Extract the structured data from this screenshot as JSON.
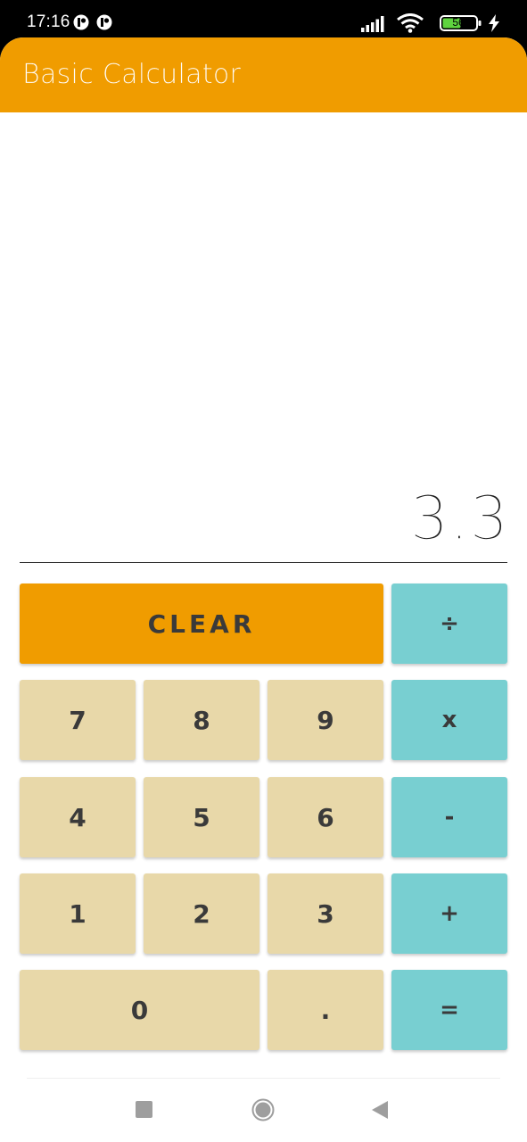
{
  "status_bar": {
    "time": "17:16",
    "battery_level": "56",
    "icons": [
      "app-notification-icon",
      "app-notification-icon",
      "signal-icon",
      "wifi-icon",
      "battery-icon",
      "charging-icon"
    ]
  },
  "app_bar": {
    "title": "Basic Calculator"
  },
  "display": {
    "value": "3.3"
  },
  "keypad": {
    "clear": "CLEAR",
    "divide": "÷",
    "multiply": "x",
    "subtract": "-",
    "add": "+",
    "equals": "=",
    "decimal": ".",
    "digits": {
      "0": "0",
      "1": "1",
      "2": "2",
      "3": "3",
      "4": "4",
      "5": "5",
      "6": "6",
      "7": "7",
      "8": "8",
      "9": "9"
    }
  },
  "colors": {
    "accent": "#f09c00",
    "number_key": "#e8d8a9",
    "operator_key": "#78cfd1"
  },
  "nav_bar": {
    "icons": [
      "recents-icon",
      "home-icon",
      "back-icon"
    ]
  }
}
